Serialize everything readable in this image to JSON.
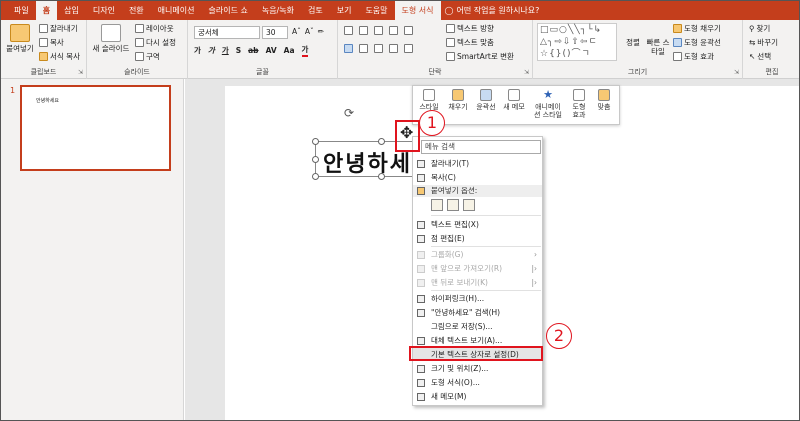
{
  "tabs": [
    "파일",
    "홈",
    "삽입",
    "디자인",
    "전환",
    "애니메이션",
    "슬라이드 쇼",
    "녹음/녹화",
    "검토",
    "보기",
    "도움말",
    "도형 서식"
  ],
  "tell_me": "어떤 작업을 원하시나요?",
  "ribbon": {
    "clipboard": {
      "label": "클립보드",
      "paste": "붙여넣기",
      "cut": "잘라내기",
      "copy": "복사",
      "format_painter": "서식 복사"
    },
    "slides": {
      "label": "슬라이드",
      "new_slide": "새 슬라이드",
      "layout": "레이아웃",
      "reset": "다시 설정",
      "section": "구역"
    },
    "font": {
      "label": "글꼴",
      "font_name": "궁서체",
      "font_size": "30"
    },
    "paragraph": {
      "label": "단락",
      "text_direction": "텍스트 방향",
      "align_text": "텍스트 맞춤",
      "smartart": "SmartArt로 변환"
    },
    "drawing": {
      "label": "그리기",
      "arrange": "정렬",
      "quick_styles": "빠른 스타일",
      "fill": "도형 채우기",
      "outline": "도형 윤곽선",
      "effects": "도형 효과"
    },
    "editing": {
      "label": "편집",
      "find": "찾기",
      "replace": "바꾸기",
      "select": "선택"
    }
  },
  "slide_panel": {
    "number": "1",
    "thumb_text": "안녕하세요"
  },
  "textbox": {
    "text": "안녕하세요"
  },
  "mini_toolbar": {
    "style": "스타일",
    "fill": "채우기",
    "outline": "윤곽선",
    "new_comment": "새 메모",
    "animation": "애니메이션 스타일",
    "shape_effects": "도형 효과",
    "arrange": "맞춤"
  },
  "context_menu": {
    "search_placeholder": "메뉴 검색",
    "items": {
      "cut": "잘라내기(T)",
      "copy": "복사(C)",
      "paste_options": "붙여넣기 옵션:",
      "edit_text": "텍스트 편집(X)",
      "edit_points": "점 편집(E)",
      "group": "그룹화(G)",
      "bring_front": "맨 앞으로 가져오기(R)",
      "send_back": "맨 뒤로 보내기(K)",
      "hyperlink": "하이퍼링크(H)...",
      "search": "\"안녕하세요\" 검색(H)",
      "save_picture": "그림으로 저장(S)...",
      "alt_text": "대체 텍스트 보기(A)...",
      "set_default": "기본 텍스트 상자로 설정(D)",
      "size_position": "크기 및 위치(Z)...",
      "format_shape": "도형 서식(O)...",
      "new_comment": "새 메모(M)"
    }
  },
  "annotations": {
    "step1": "1",
    "step2": "2",
    "color": "#e0141e"
  },
  "colors": {
    "accent": "#c43e1c",
    "highlight": "#e0141e"
  }
}
